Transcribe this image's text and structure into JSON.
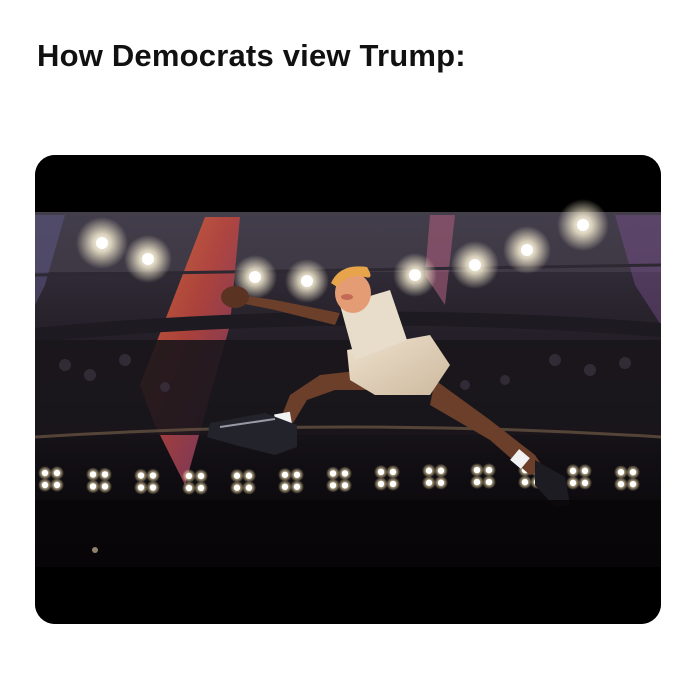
{
  "post": {
    "caption": "How Democrats view Trump:"
  },
  "media": {
    "kind": "video-still",
    "description_icon": "dunk-scene-image",
    "colors": {
      "background": "#ffffff",
      "letterbox": "#000000",
      "arena_dark": "#16131a",
      "light": "#ffffff",
      "curtain": "#d2563a"
    }
  }
}
